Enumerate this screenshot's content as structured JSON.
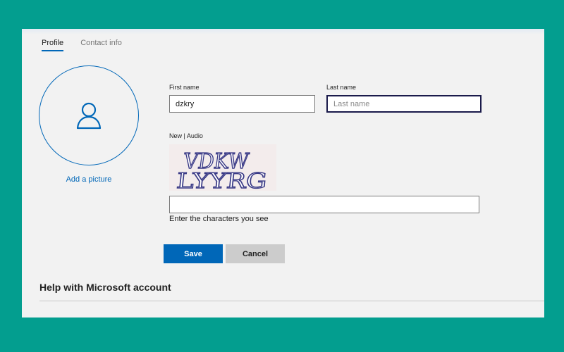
{
  "tabs": [
    {
      "label": "Profile",
      "active": true
    },
    {
      "label": "Contact info",
      "active": false
    }
  ],
  "avatar": {
    "icon": "person-icon",
    "add_picture_label": "Add a picture"
  },
  "form": {
    "first_name": {
      "label": "First name",
      "value": "dzkry",
      "placeholder": ""
    },
    "last_name": {
      "label": "Last name",
      "value": "",
      "placeholder": "Last name"
    },
    "captcha": {
      "new_label": "New",
      "separator": "|",
      "audio_label": "Audio",
      "image_text": "VDKW LYYRG",
      "line1": "VDKW",
      "line2": "LYYRG",
      "input_value": "",
      "hint": "Enter the characters you see"
    }
  },
  "buttons": {
    "save_label": "Save",
    "cancel_label": "Cancel"
  },
  "help": {
    "title": "Help with Microsoft account"
  },
  "colors": {
    "background": "#039e8f",
    "panel": "#f2f2f2",
    "accent": "#0067b8",
    "cancel": "#cccccc"
  }
}
